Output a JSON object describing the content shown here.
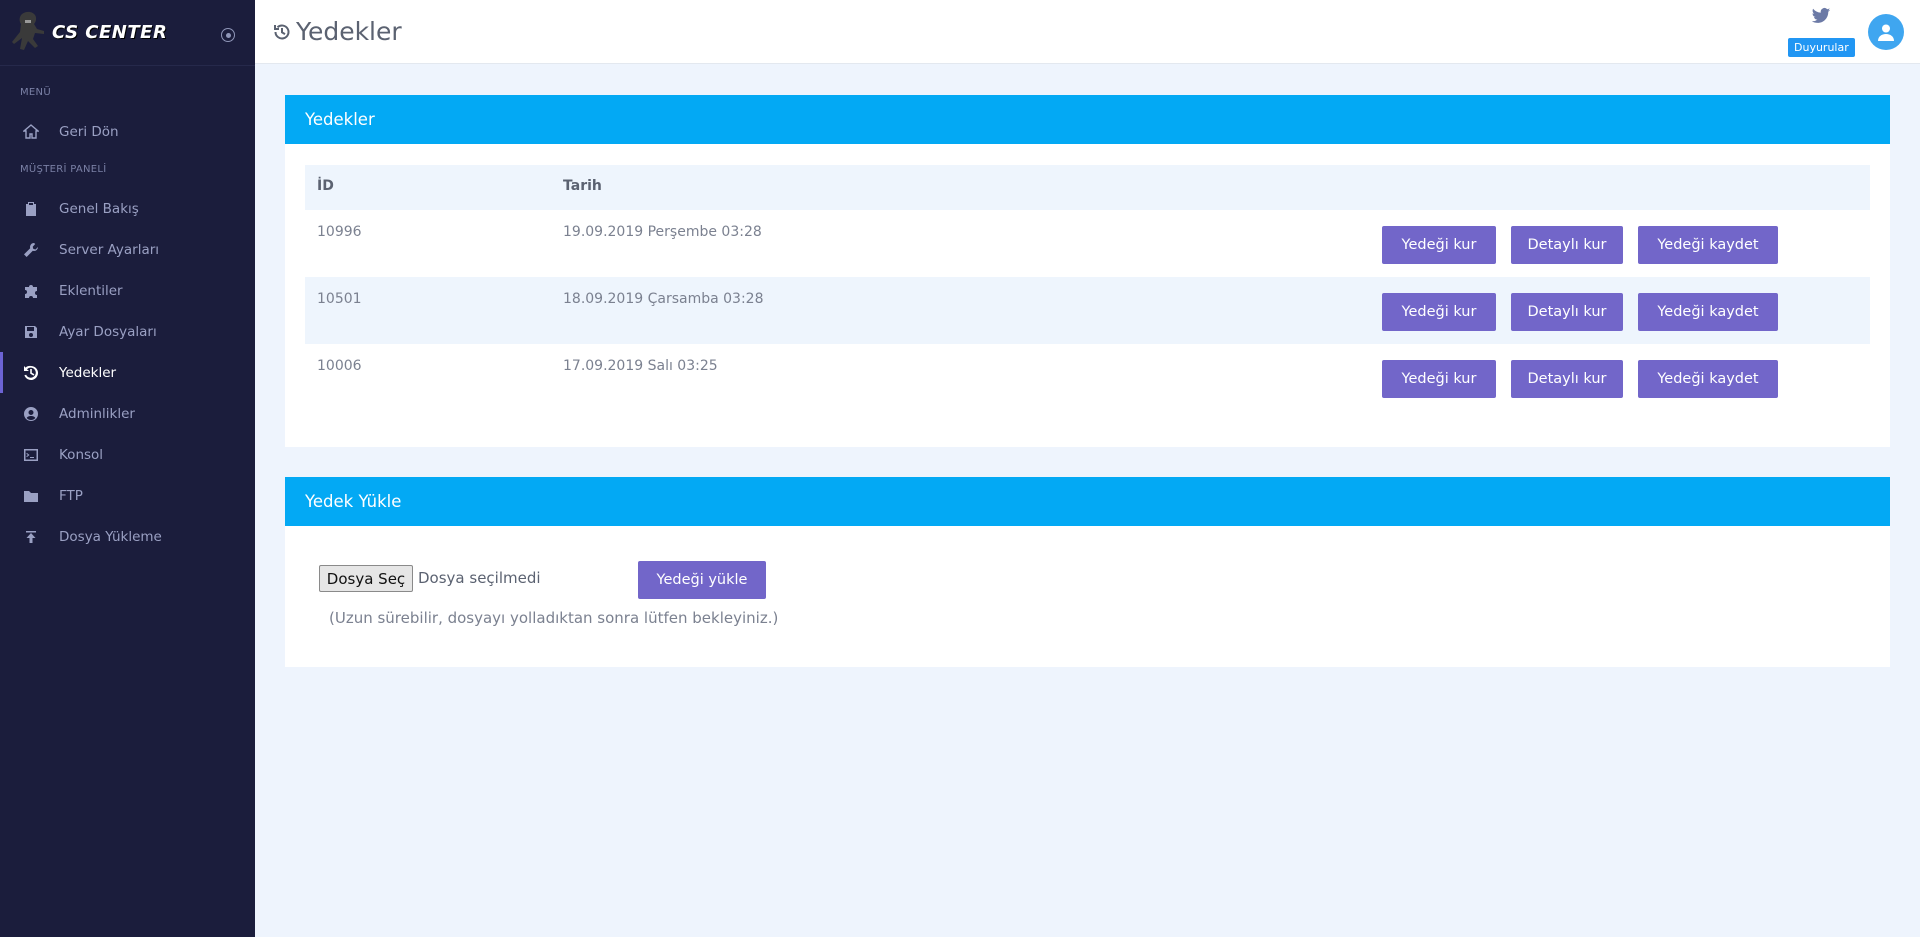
{
  "brand": {
    "name": "CS CENTER"
  },
  "sidebar": {
    "section_menu": "MENÜ",
    "section_panel": "MÜŞTERİ PANELİ",
    "items": [
      {
        "label": "Geri Dön",
        "icon": "home-icon"
      },
      {
        "label": "Genel Bakış",
        "icon": "clipboard-icon"
      },
      {
        "label": "Server Ayarları",
        "icon": "wrench-icon"
      },
      {
        "label": "Eklentiler",
        "icon": "puzzle-icon"
      },
      {
        "label": "Ayar Dosyaları",
        "icon": "floppy-icon"
      },
      {
        "label": "Yedekler",
        "icon": "history-icon"
      },
      {
        "label": "Adminlikler",
        "icon": "user-circle-icon"
      },
      {
        "label": "Konsol",
        "icon": "terminal-icon"
      },
      {
        "label": "FTP",
        "icon": "folder-icon"
      },
      {
        "label": "Dosya Yükleme",
        "icon": "upload-icon"
      }
    ],
    "active": "Yedekler"
  },
  "header": {
    "title": "Yedekler",
    "announcements": "Duyurular"
  },
  "backups": {
    "title": "Yedekler",
    "columns": {
      "id": "İD",
      "date": "Tarih"
    },
    "rows": [
      {
        "id": "10996",
        "date": "19.09.2019 Perşembe 03:28"
      },
      {
        "id": "10501",
        "date": "18.09.2019 Çarsamba 03:28"
      },
      {
        "id": "10006",
        "date": "17.09.2019 Salı 03:25"
      }
    ],
    "actions": {
      "restore": "Yedeği kur",
      "detailed": "Detaylı kur",
      "save": "Yedeği kaydet"
    }
  },
  "upload": {
    "title": "Yedek Yükle",
    "choose": "Dosya Seç",
    "no_file": "Dosya seçilmedi",
    "submit": "Yedeği yükle",
    "note": "(Uzun sürebilir, dosyayı yolladıktan sonra lütfen bekleyiniz.)"
  },
  "colors": {
    "sidebar": "#1b1d3c",
    "accent": "#03a9f4",
    "button": "#7266c9",
    "background": "#eef4fd"
  }
}
